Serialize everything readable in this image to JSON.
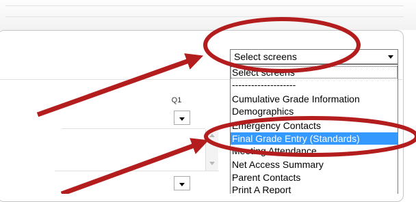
{
  "screen_select": {
    "value": "Select screens",
    "options": [
      {
        "label": "Select screens",
        "selected": false
      },
      {
        "label": "--------------------",
        "selected": false
      },
      {
        "label": "Cumulative Grade Information",
        "selected": false
      },
      {
        "label": "Demographics",
        "selected": false
      },
      {
        "label": "Emergency Contacts",
        "selected": false
      },
      {
        "label": "Final Grade Entry (Standards)",
        "selected": true
      },
      {
        "label": "Meeting Attendance",
        "selected": false
      },
      {
        "label": "Net Access Summary",
        "selected": false
      },
      {
        "label": "Parent Contacts",
        "selected": false
      },
      {
        "label": "Print A Report",
        "selected": false
      }
    ]
  },
  "grade_column": {
    "header": "Q1"
  },
  "colors": {
    "annotation": "#b31d1d",
    "highlight": "#3399ff"
  }
}
